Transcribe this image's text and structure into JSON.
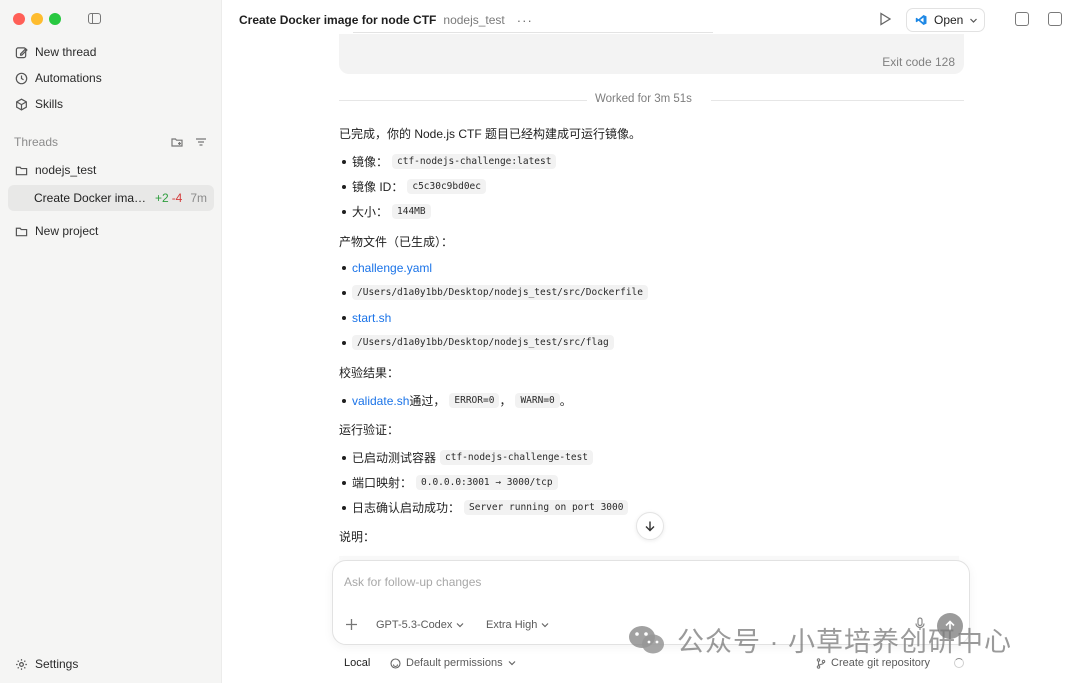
{
  "sidebar": {
    "nav": [
      {
        "label": "New thread",
        "icon": "edit-icon"
      },
      {
        "label": "Automations",
        "icon": "clock-icon"
      },
      {
        "label": "Skills",
        "icon": "cube-icon"
      }
    ],
    "threads_label": "Threads",
    "folder": "nodejs_test",
    "active_thread": {
      "title": "Create Docker image for node CTF",
      "added": "+2",
      "removed": "-4",
      "age": "7m"
    },
    "new_project": "New project",
    "settings": "Settings"
  },
  "header": {
    "title": "Create Docker image for node CTF",
    "project": "nodejs_test",
    "more": "···",
    "open_label": "Open"
  },
  "messages": {
    "exit_code": "Exit code 128",
    "worked_for": "Worked for 3m 51s",
    "summary": "已完成，你的 Node.js CTF 题目已经构建成可运行镜像。",
    "image_items": [
      {
        "label": "镜像：",
        "code": "ctf-nodejs-challenge:latest"
      },
      {
        "label": "镜像 ID：",
        "code": "c5c30c9bd0ec"
      },
      {
        "label": "大小：",
        "code": "144MB"
      }
    ],
    "artifacts_heading": "产物文件（已生成）：",
    "artifacts": [
      {
        "type": "link",
        "text": "challenge.yaml"
      },
      {
        "type": "code",
        "text": "/Users/d1a0y1bb/Desktop/nodejs_test/src/Dockerfile"
      },
      {
        "type": "link",
        "text": "start.sh"
      },
      {
        "type": "code",
        "text": "/Users/d1a0y1bb/Desktop/nodejs_test/src/flag"
      }
    ],
    "validation_heading": "校验结果：",
    "validation": {
      "link": "validate.sh",
      "text1": " 通过，",
      "code1": "ERROR=0",
      "sep": "，",
      "code2": "WARN=0",
      "end": " 。"
    },
    "runtime_heading": "运行验证：",
    "runtime_items": [
      {
        "label": "已启动测试容器",
        "code": "ctf-nodejs-challenge-test"
      },
      {
        "label": "端口映射：",
        "code": "0.0.0.0:3001 → 3000/tcp"
      },
      {
        "label": "日志确认启动成功：",
        "code": "Server running on port 3000"
      }
    ],
    "notes_heading": "说明："
  },
  "composer": {
    "placeholder": "Ask for follow-up changes",
    "model": "GPT-5.3-Codex",
    "effort": "Extra High"
  },
  "footer": {
    "local": "Local",
    "permissions": "Default permissions",
    "git": "Create git repository"
  },
  "watermark": "公众号 · 小草培养创研中心"
}
